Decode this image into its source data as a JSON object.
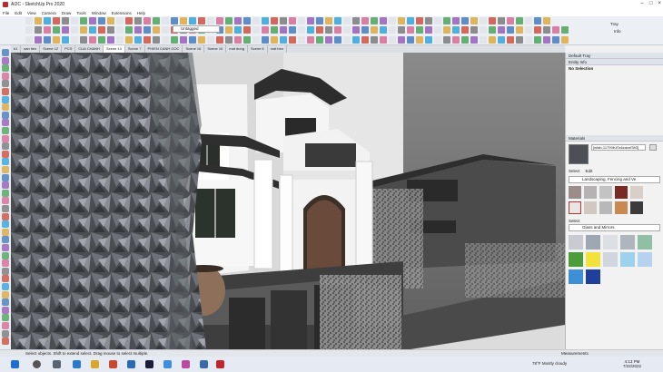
{
  "window": {
    "title": "AI2C - SketchUp Pro 2020"
  },
  "menu": [
    "File",
    "Edit",
    "View",
    "Camera",
    "Draw",
    "Tools",
    "Window",
    "Extensions",
    "Help"
  ],
  "layer": {
    "current": "Untagged"
  },
  "tray_labels": {
    "tray": "Tray",
    "info": "Info"
  },
  "scenes": [
    "k1",
    "san tien",
    "Scene 12",
    "PCS",
    "CUA CHANH",
    "Scene 14",
    "Scene 7",
    "PHIEN CANH GOC",
    "Scene 16",
    "Scene 10",
    "mat dung",
    "Scene 6",
    "mat ben"
  ],
  "active_scene": "Scene 14",
  "right_tray": {
    "title": "Default Tray",
    "entity_info": {
      "title": "Entity Info",
      "value": "No Selection"
    },
    "materials": {
      "title": "Materials",
      "name": "[wfab-11799b-f0c6cacef3b3]",
      "select_label": "Select",
      "edit_label": "Edit",
      "library1": "Landscaping, Fencing and Ve",
      "library2_label": "Select",
      "library2": "Glass and Mirrors"
    }
  },
  "status": {
    "hint": "Select objects. Shift to extend select. Drag mouse to select multiple.",
    "measurements_label": "Measurements"
  },
  "taskbar": {
    "weather_temp": "78°F",
    "weather_desc": "Mostly cloudy",
    "time": "4:13 PM",
    "date": "7/22/2022"
  },
  "colors": {
    "accent": "#c0262d",
    "tray_bg": "#f2f2f2",
    "taskbar_bg": "#e6ebf3"
  }
}
